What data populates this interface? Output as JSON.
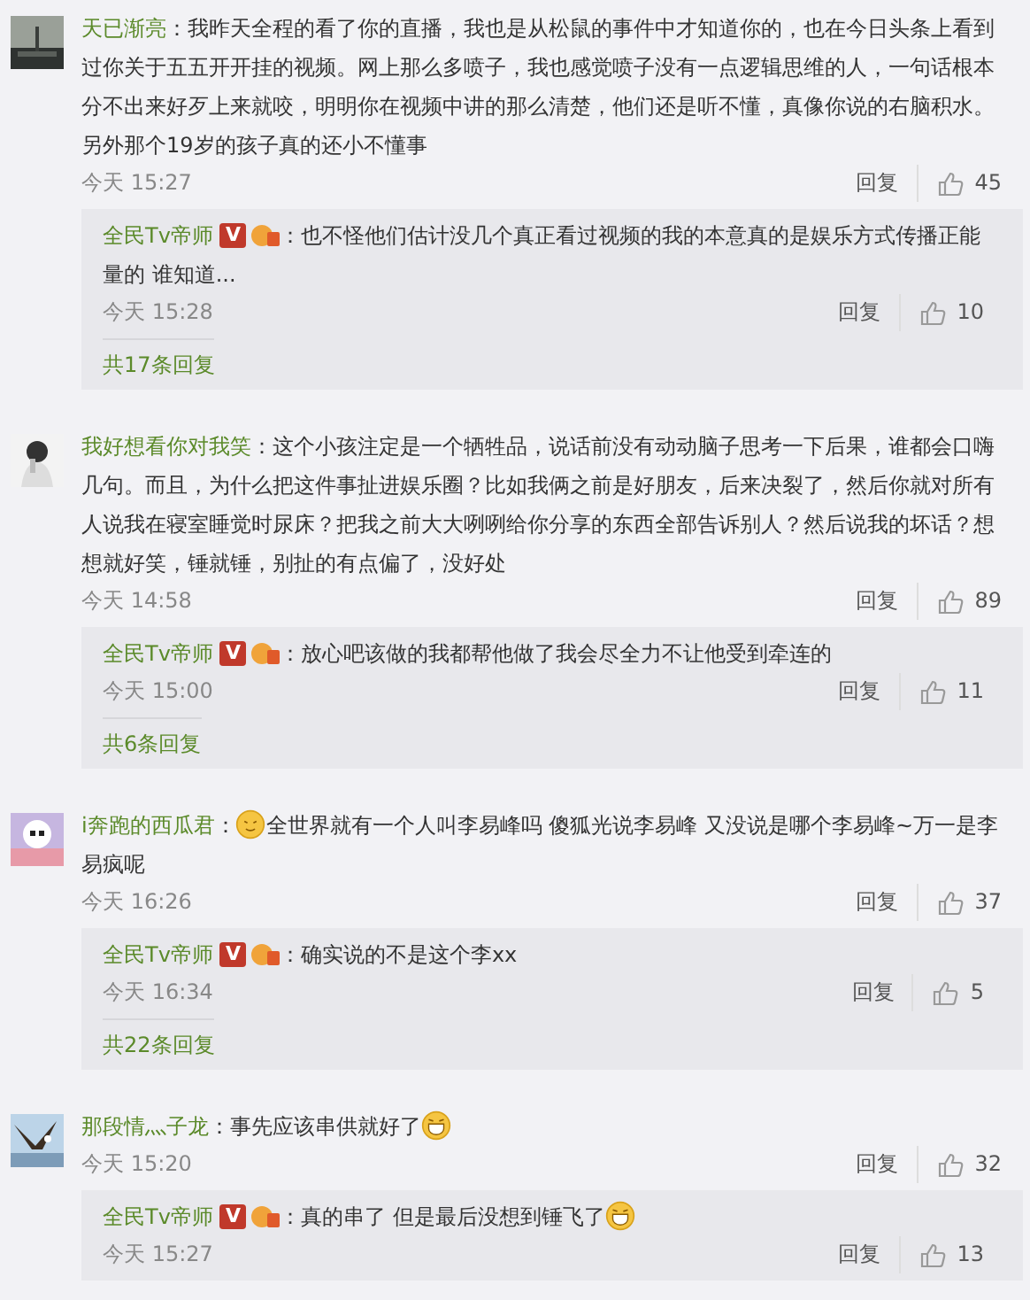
{
  "comments": [
    {
      "kind": "text",
      "user": "天已渐亮",
      "colon": "：",
      "text": "我昨天全程的看了你的直播，我也是从松鼠的事件中才知道你的，也在今日头条上看到过你关于五五开开挂的视频。网上那么多喷子，我也感觉喷子没有一点逻辑思维的人，一句话根本分不出来好歹上来就咬，明明你在视频中讲的那么清楚，他们还是听不懂，真像你说的右脑积水。另外那个19岁的孩子真的还小不懂事",
      "time": "今天 15:27",
      "reply_label": "回复",
      "likes": "45",
      "replies": [
        {
          "kind": "text",
          "user": "全民Tv帝师",
          "verified": "V",
          "colon": "：",
          "text": "也不怪他们估计没几个真正看过视频的我的本意真的是娱乐方式传播正能量的 谁知道...",
          "time": "今天 15:28",
          "reply_label": "回复",
          "likes": "10"
        }
      ],
      "more": "共17条回复"
    },
    {
      "kind": "text",
      "user": "我好想看你对我笑",
      "colon": "：",
      "text": "这个小孩注定是一个牺牲品，说话前没有动动脑子思考一下后果，谁都会口嗨几句。而且，为什么把这件事扯进娱乐圈？比如我俩之前是好朋友，后来决裂了，然后你就对所有人说我在寝室睡觉时尿床？把我之前大大咧咧给你分享的东西全部告诉别人？然后说我的坏话？想想就好笑，锤就锤，别扯的有点偏了，没好处",
      "time": "今天 14:58",
      "reply_label": "回复",
      "likes": "89",
      "replies": [
        {
          "kind": "text",
          "user": "全民Tv帝师",
          "verified": "V",
          "colon": "：",
          "text": "放心吧该做的我都帮他做了我会尽全力不让他受到牵连的",
          "time": "今天 15:00",
          "reply_label": "回复",
          "likes": "11"
        }
      ],
      "more": "共6条回复"
    },
    {
      "kind": "emoji-first",
      "user": "i奔跑的西瓜君",
      "colon": "：",
      "text": "全世界就有一个人叫李易峰吗 傻狐光说李易峰 又没说是哪个李易峰~万一是李易疯呢",
      "time": "今天 16:26",
      "reply_label": "回复",
      "likes": "37",
      "replies": [
        {
          "kind": "text",
          "user": "全民Tv帝师",
          "verified": "V",
          "colon": "：",
          "text": "确实说的不是这个李xx",
          "time": "今天 16:34",
          "reply_label": "回复",
          "likes": "5"
        }
      ],
      "more": "共22条回复"
    },
    {
      "kind": "emoji-last",
      "user": "那段情灬子龙",
      "colon": "：",
      "text": "事先应该串供就好了",
      "time": "今天 15:20",
      "reply_label": "回复",
      "likes": "32",
      "replies": [
        {
          "kind": "emoji-last",
          "user": "全民Tv帝师",
          "verified": "V",
          "colon": "：",
          "text": "真的串了 但是最后没想到锤飞了",
          "time": "今天 15:27",
          "reply_label": "回复",
          "likes": "13"
        }
      ]
    }
  ]
}
